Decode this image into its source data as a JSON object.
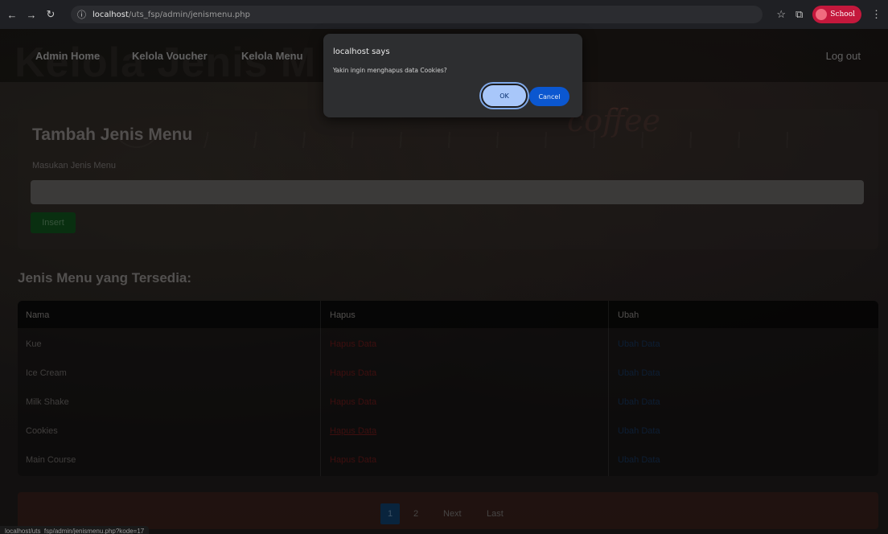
{
  "browser": {
    "url_host": "localhost",
    "url_path": "/uts_fsp/admin/jenismenu.php",
    "profile_label": "School"
  },
  "background": {
    "title_text": "Kelola Jenis M",
    "coffee_text": "coffee"
  },
  "nav": {
    "items": [
      "Admin Home",
      "Kelola Voucher",
      "Kelola Menu"
    ],
    "logout": "Log out"
  },
  "form": {
    "title": "Tambah Jenis Menu",
    "label": "Masukan Jenis Menu",
    "input_value": "",
    "insert_label": "Insert"
  },
  "list": {
    "title": "Jenis Menu yang Tersedia:",
    "columns": [
      "Nama",
      "Hapus",
      "Ubah"
    ],
    "rows": [
      {
        "name": "Kue",
        "delete": "Hapus Data",
        "edit": "Ubah Data"
      },
      {
        "name": "Ice Cream",
        "delete": "Hapus Data",
        "edit": "Ubah Data"
      },
      {
        "name": "Milk Shake",
        "delete": "Hapus Data",
        "edit": "Ubah Data"
      },
      {
        "name": "Cookies",
        "delete": "Hapus Data",
        "edit": "Ubah Data"
      },
      {
        "name": "Main Course",
        "delete": "Hapus Data",
        "edit": "Ubah Data"
      }
    ]
  },
  "pagination": {
    "pages": [
      "1",
      "2"
    ],
    "current_page": "1",
    "next": "Next",
    "last": "Last"
  },
  "status_url": "localhost/uts_fsp/admin/jenismenu.php?kode=17",
  "dialog": {
    "title": "localhost says",
    "message": "Yakin ingin menghapus data Cookies?",
    "ok_label": "OK",
    "cancel_label": "Cancel"
  },
  "colors": {
    "ok_button": "#a8c7fa",
    "cancel_button": "#0b57d0",
    "delete_link": "#6b1a1a",
    "edit_link": "#17355b",
    "insert_button": "#10521c",
    "active_page": "#103e6a"
  }
}
